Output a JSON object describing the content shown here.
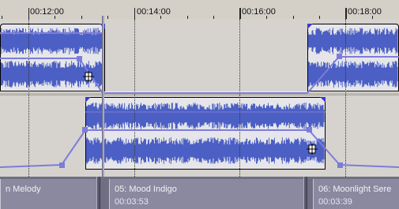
{
  "ruler": {
    "labels": [
      "00:12:00",
      "00:14:00",
      "00:16:00",
      "00:18:00"
    ]
  },
  "clips": [
    {
      "name": "n Melody",
      "time": ""
    },
    {
      "name": "05: Mood Indigo",
      "time": "00:03:53"
    },
    {
      "name": "06: Moonlight Sere",
      "time": "00:03:39"
    }
  ],
  "colors": {
    "waveform": "#4b5fc4",
    "envelope": "#7d7cd9",
    "clip_bar": "#8a89a0"
  }
}
